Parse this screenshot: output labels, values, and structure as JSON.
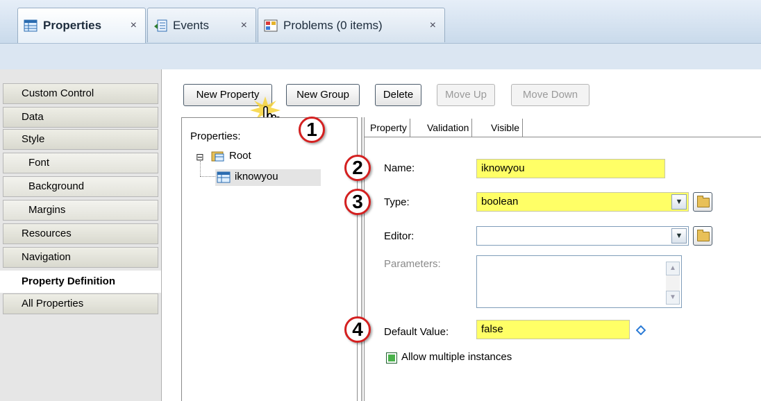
{
  "tabs": [
    {
      "label": "Properties",
      "active": true,
      "icon": "properties-icon"
    },
    {
      "label": "Events",
      "active": false,
      "icon": "events-icon"
    },
    {
      "label": "Problems (0 items)",
      "active": false,
      "icon": "problems-icon"
    }
  ],
  "tab_close": "×",
  "nav": {
    "items": [
      {
        "label": "Custom Control"
      },
      {
        "label": "Data"
      },
      {
        "label": "Style"
      },
      {
        "label": "Font"
      },
      {
        "label": "Background"
      },
      {
        "label": "Margins"
      },
      {
        "label": "Resources"
      },
      {
        "label": "Navigation"
      },
      {
        "label": "Property Definition",
        "selected": true
      },
      {
        "label": "All Properties"
      }
    ]
  },
  "toolbar": {
    "new_property": "New Property",
    "new_group": "New Group",
    "delete": "Delete",
    "move_up": "Move Up",
    "move_down": "Move Down"
  },
  "tree": {
    "header": "Properties:",
    "expander": "⊟",
    "root": "Root",
    "child": "iknowyou"
  },
  "subtabs": [
    "Property",
    "Validation",
    "Visible"
  ],
  "form": {
    "name_label": "Name:",
    "name_value": "iknowyou",
    "type_label": "Type:",
    "type_value": "boolean",
    "editor_label": "Editor:",
    "editor_value": "",
    "parameters_label": "Parameters:",
    "default_label": "Default Value:",
    "default_value": "false",
    "allow_multiple_label": "Allow multiple instances",
    "allow_multiple_checked": true
  },
  "callouts": [
    "1",
    "2",
    "3",
    "4"
  ],
  "colors": {
    "highlight_field": "#ffff66",
    "callout_border": "#d42020",
    "checkbox_fill": "#49b24a"
  }
}
